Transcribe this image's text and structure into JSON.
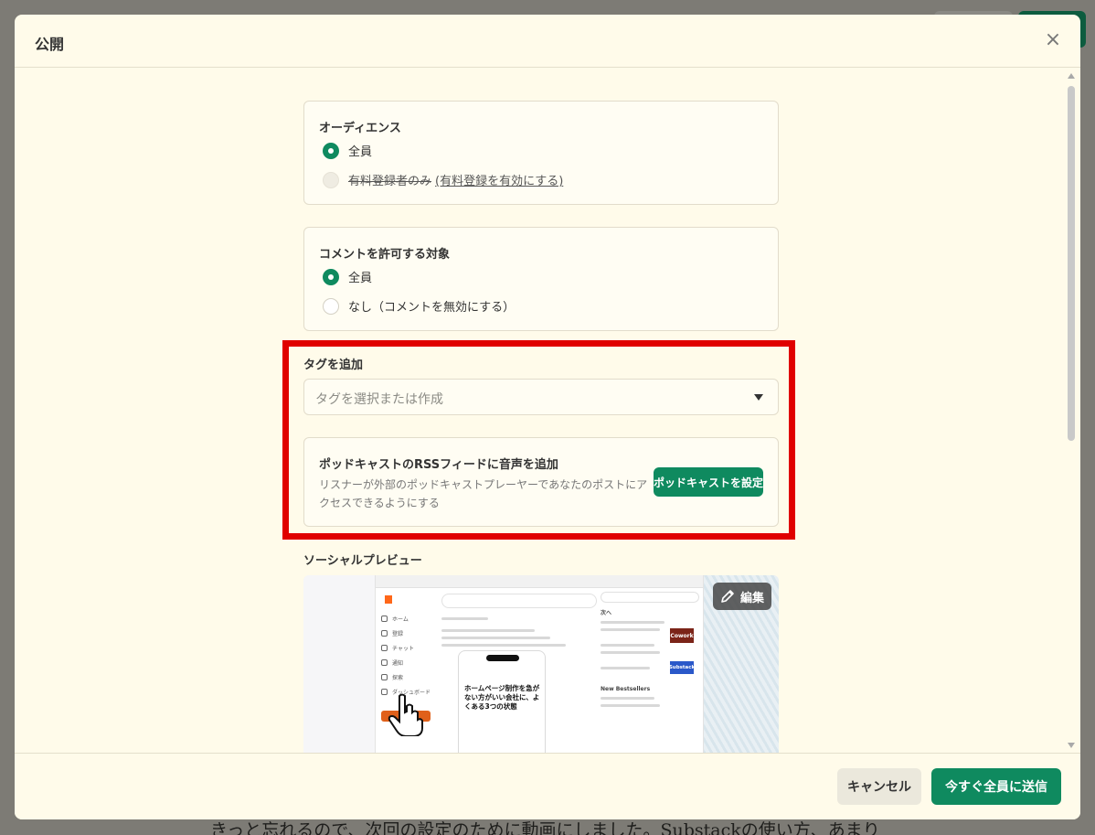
{
  "modal": {
    "title": "公開",
    "close_label": "×"
  },
  "audience": {
    "title": "オーディエンス",
    "options": [
      {
        "label": "全員",
        "checked": true
      },
      {
        "label": "有料登録者のみ",
        "disabled": true,
        "link": "(有料登録を有効にする)"
      }
    ]
  },
  "comments": {
    "title": "コメントを許可する対象",
    "options": [
      {
        "label": "全員",
        "checked": true
      },
      {
        "label": "なし（コメントを無効にする）",
        "checked": false
      }
    ]
  },
  "tags": {
    "title": "タグを追加",
    "placeholder": "タグを選択または作成"
  },
  "podcast": {
    "title": "ポッドキャストのRSSフィードに音声を追加",
    "description": "リスナーが外部のポッドキャストプレーヤーであなたのポストにアクセスできるようにする",
    "button": "ポッドキャストを設定"
  },
  "social_preview": {
    "title": "ソーシャルプレビュー",
    "edit_button": "編集",
    "thumbnail": {
      "headline": "ホームページ制作を急がない方がいい会社に、よくある3つの状態",
      "cowork_badge": "Cowork",
      "substack_badge": "Substack",
      "nav_items": [
        "ホーム",
        "登録",
        "チャット",
        "通知",
        "探索",
        "ダッシュボード"
      ],
      "side_heading_1": "次へ",
      "side_heading_2": "New Bestsellers"
    }
  },
  "footer": {
    "cancel": "キャンセル",
    "send": "今すぐ全員に送信"
  },
  "background": {
    "text": "きっと忘れるので、次回の設定のために動画にしました。Substackの使い方、あまり"
  },
  "colors": {
    "accent": "#0f8a5f",
    "highlight": "#e00000",
    "modal_bg": "#fffbea"
  }
}
